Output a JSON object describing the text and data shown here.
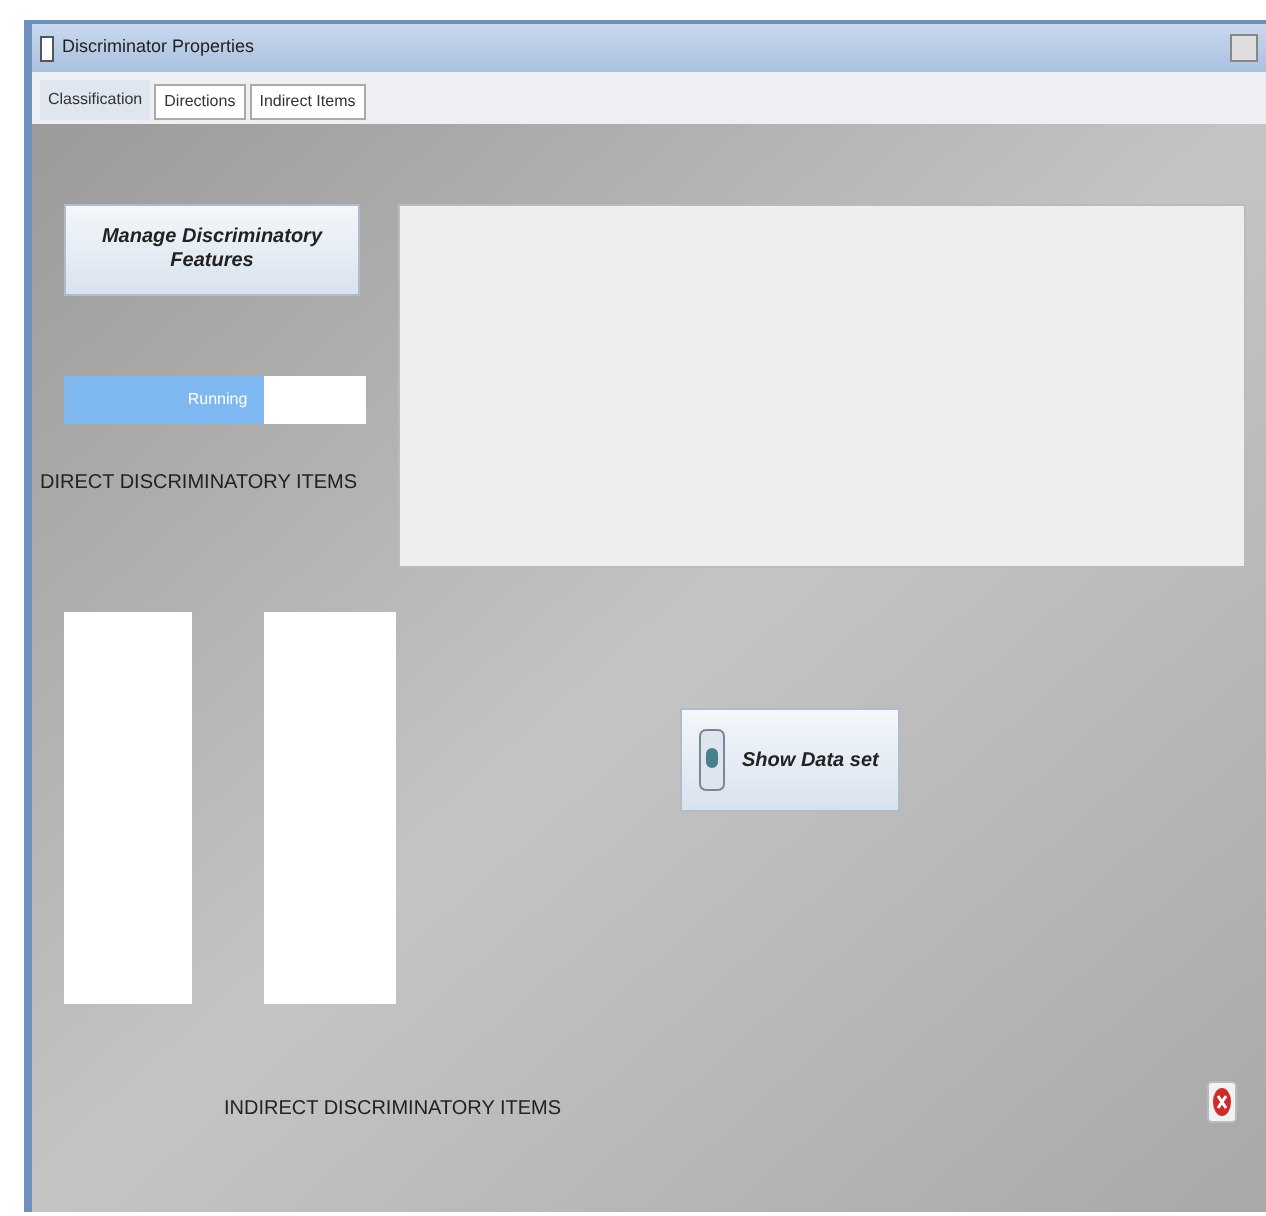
{
  "window": {
    "title": "Discriminator Properties"
  },
  "tabs": [
    {
      "label": "Classification",
      "selected": true
    },
    {
      "label": "Directions",
      "selected": false
    },
    {
      "label": "Indirect Items",
      "selected": false
    }
  ],
  "manage_button": {
    "label": "Manage Discriminatory Features"
  },
  "progress": {
    "label": "Running",
    "level": 0.66
  },
  "direct_label": "DIRECT DISCRIMINATORY ITEMS",
  "indirect_label": "INDIRECT DISCRIMINATORY ITEMS",
  "show_button": {
    "label": "Show Data set"
  }
}
